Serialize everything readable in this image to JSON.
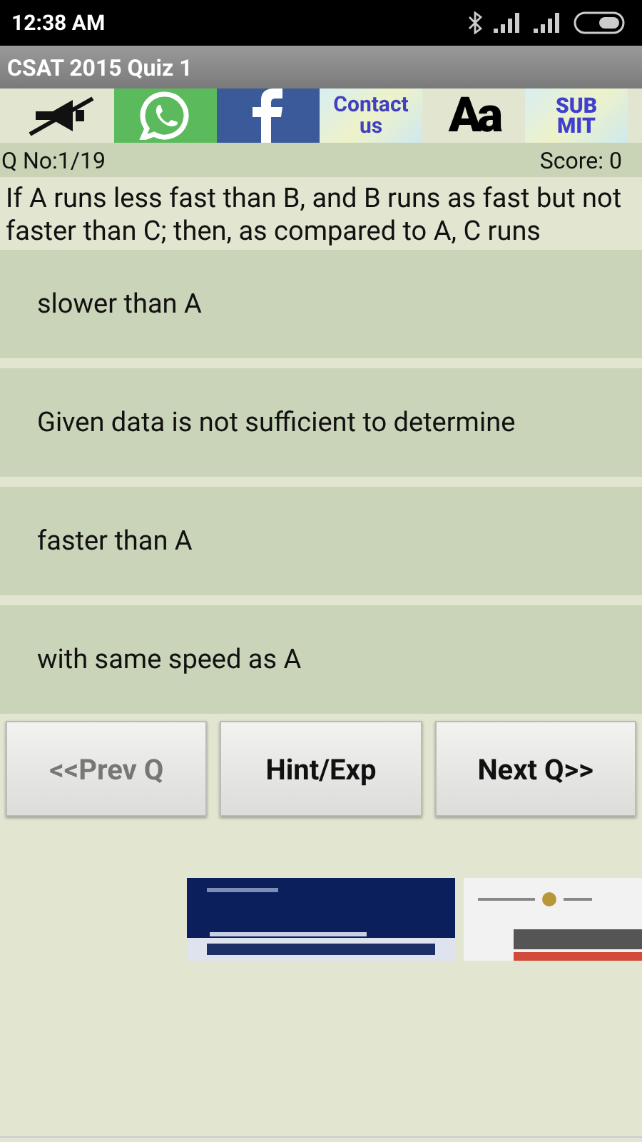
{
  "status_bar": {
    "time": "12:38 AM"
  },
  "title": "CSAT 2015 Quiz 1",
  "toolbar": [
    {
      "kind": "mute"
    },
    {
      "kind": "chat"
    },
    {
      "kind": "facebook"
    },
    {
      "kind": "text",
      "label": "Contact us"
    },
    {
      "kind": "font",
      "label": "Aa"
    },
    {
      "kind": "submit",
      "label": "SUB MIT"
    }
  ],
  "question_number": "Q No:1/19",
  "score": "Score: 0",
  "question": "If A runs less fast than B, and B runs as fast but not faster than C; then, as compared to A, C runs",
  "options": [
    "slower than A",
    "Given data is not sufficient to determine",
    "faster than A",
    "with same speed as A"
  ],
  "buttons": [
    {
      "label": "<<Prev Q",
      "disabled": true
    },
    {
      "label": "Hint/Exp",
      "disabled": false
    },
    {
      "label": "Next Q>>",
      "disabled": false
    }
  ]
}
